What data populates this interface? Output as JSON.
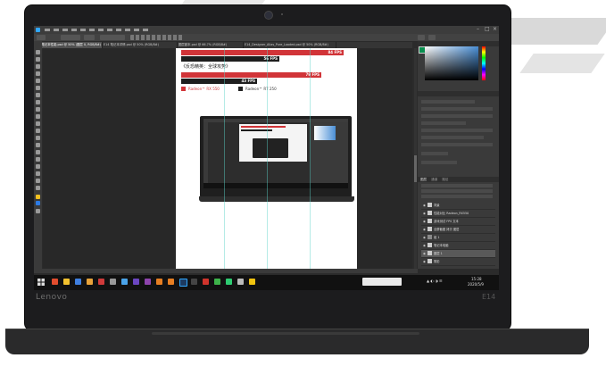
{
  "device": {
    "brand": "Lenovo",
    "model": "E14"
  },
  "photoshop": {
    "tabs": [
      "E14笔记本性能.psd @ 50% (图层 0, RGB/8#)",
      "E14 笔记本详情.psd @ 50% (RGB/8#)",
      "图层副本.psd @ 66.7% (RGB/8#)",
      "E14_Designer_Alias_Pure_Loaded.psd @ 50% (RGB/8#)"
    ],
    "layers_panel_tabs": [
      "图层",
      "通道",
      "路径"
    ],
    "layers": [
      {
        "name": "背景",
        "selected": false
      },
      {
        "name": "性能对比 Radeon_RX550",
        "selected": false
      },
      {
        "name": "游戏测试 FPS 文本",
        "selected": false
      },
      {
        "name": "全屏截图 拷贝 图层",
        "selected": false
      },
      {
        "name": "组 1",
        "selected": false
      },
      {
        "name": "笔记本电脑",
        "selected": false
      },
      {
        "name": "图层 1",
        "selected": true
      },
      {
        "name": "阴影",
        "selected": false
      },
      {
        "name": "背景",
        "selected": false
      }
    ],
    "taskbar_time": "15:28",
    "taskbar_date": "2020/5/9"
  },
  "doc": {
    "bar1_label": "84 FPS",
    "bar2_label": "56 FPS",
    "heading": "《反恐精英：全球攻势》",
    "bar3_label": "79 FPS",
    "bar4_label": "43 FPS",
    "legend": [
      {
        "label": "Radeon™ RX 550",
        "color": "#d13438"
      },
      {
        "label": "Radeon™ R7 250",
        "color": "#222222"
      }
    ]
  },
  "colors": {
    "red_bar": "#d13438",
    "dark_bar": "#1e1e1e",
    "guide": "#5ad2c8",
    "ps_dark": "#2b2b2b"
  }
}
